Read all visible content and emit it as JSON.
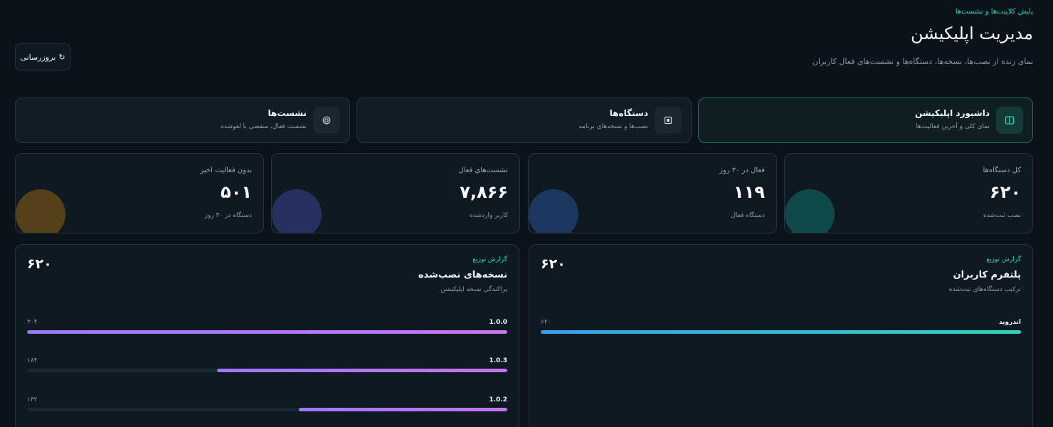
{
  "header": {
    "eyebrow": "پایش کلاینت‌ها و نشست‌ها",
    "title": "مدیریت اپلیکیشن",
    "subtitle": "نمای زنده از نصب‌ها، نسخه‌ها، دستگاه‌ها و نشست‌های فعال کاربران",
    "refresh_label": "بروزرسانی",
    "refresh_icon": "↻"
  },
  "nav": [
    {
      "title": "داشبورد اپلیکیشن",
      "desc": "نمای کلی و آخرین فعالیت‌ها",
      "icon": "layout-icon",
      "active": true
    },
    {
      "title": "دستگاه‌ها",
      "desc": "نصب‌ها و نسخه‌های برنامه",
      "icon": "device-icon",
      "active": false
    },
    {
      "title": "نشست‌ها",
      "desc": "نشست فعال، منقضی یا لغوشده",
      "icon": "target-icon",
      "active": false
    }
  ],
  "stats": [
    {
      "label": "کل دستگاه‌ها",
      "value": "۶۲۰",
      "caption": "نصب ثبت‌شده",
      "color": "#14b8a6"
    },
    {
      "label": "فعال در ۳۰ روز",
      "value": "۱۱۹",
      "caption": "دستگاه فعال",
      "color": "#3b82f6"
    },
    {
      "label": "نشست‌های فعال",
      "value": "۷,۸۶۶",
      "caption": "کاربر واردشده",
      "color": "#6366f1"
    },
    {
      "label": "بدون فعالیت اخیر",
      "value": "۵۰۱",
      "caption": "دستگاه در ۳۰ روز",
      "color": "#f59e0b"
    }
  ],
  "panels": {
    "platform": {
      "eyebrow": "گزارش توزیع",
      "title": "پلتفرم کاربران",
      "subtitle": "ترکیب دستگاه‌های ثبت‌شده",
      "total": "۶۲۰",
      "rows": [
        {
          "name": "اندروید",
          "count": "۶۲۰",
          "share": 1.0
        }
      ]
    },
    "versions": {
      "eyebrow": "گزارش توزیع",
      "title": "نسخه‌های نصب‌شده",
      "subtitle": "پراکندگی نسخه اپلیکیشن",
      "total": "۶۲۰",
      "rows": [
        {
          "name": "1.0.0",
          "count": "۳۰۴",
          "share": 1.0
        },
        {
          "name": "1.0.3",
          "count": "۱۸۴",
          "share": 0.605
        },
        {
          "name": "1.0.2",
          "count": "۱۳۲",
          "share": 0.434
        }
      ]
    }
  }
}
